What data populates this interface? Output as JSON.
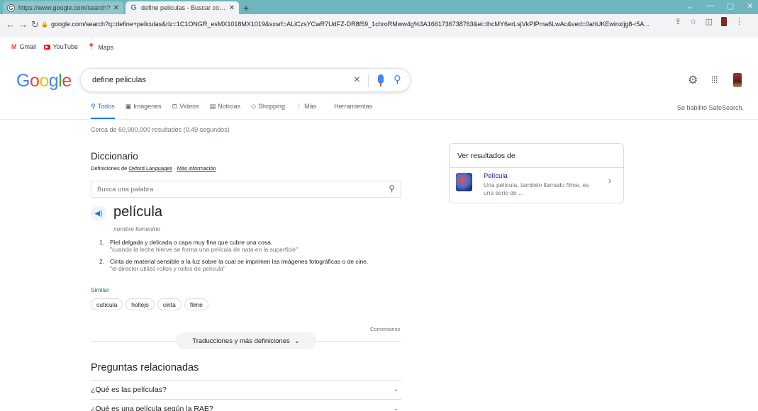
{
  "browser": {
    "tabs": [
      {
        "title": "https://www.google.com/search?",
        "active": false
      },
      {
        "title": "define peliculas - Buscar con Goo",
        "active": true
      }
    ],
    "new_tab": "+",
    "url": "google.com/search?q=define+peliculas&rlz=1C1ONGR_esMX1018MX1019&sxsrf=ALiCzsYCwR7UdFZ-DR8f59_1chroRMww4g%3A1661736738763&ei=lhcMY6erLsjVkPIPma6LwAc&ved=0ahUKEwinxljg8-r5A...",
    "bookmarks": [
      {
        "label": "Gmail",
        "icon": "gmail-icon"
      },
      {
        "label": "YouTube",
        "icon": "youtube-icon"
      },
      {
        "label": "Maps",
        "icon": "maps-icon"
      }
    ]
  },
  "google": {
    "logo_letters": [
      {
        "ch": "G",
        "color": "#4285F4"
      },
      {
        "ch": "o",
        "color": "#EA4335"
      },
      {
        "ch": "o",
        "color": "#FBBC05"
      },
      {
        "ch": "g",
        "color": "#4285F4"
      },
      {
        "ch": "l",
        "color": "#34A853"
      },
      {
        "ch": "e",
        "color": "#EA4335"
      }
    ],
    "query": "define peliculas",
    "tabs": [
      {
        "label": "Todos",
        "icon": "search-icon",
        "active": true
      },
      {
        "label": "Imágenes",
        "icon": "image-icon",
        "active": false
      },
      {
        "label": "Videos",
        "icon": "video-icon",
        "active": false
      },
      {
        "label": "Noticias",
        "icon": "news-icon",
        "active": false
      },
      {
        "label": "Shopping",
        "icon": "tag-icon",
        "active": false
      },
      {
        "label": "Más",
        "icon": "more-icon",
        "active": false
      },
      {
        "label": "Herramientas",
        "icon": "",
        "active": false
      }
    ],
    "safesearch": "Se habilitó SafeSearch.",
    "results_stats": "Cerca de 60,900,000 resultados (0.49 segundos)"
  },
  "dictionary": {
    "title": "Diccionario",
    "source_prefix": "Definiciones de",
    "source_name": "Oxford Languages",
    "source_sep": " · ",
    "more_info": "Más información",
    "search_placeholder": "Busca una palabra",
    "word": "película",
    "part_of_speech": "nombre femenino",
    "definitions": [
      {
        "num": "1.",
        "text": "Piel delgada y delicada o capa muy fina que cubre una cosa.",
        "example": "\"cuando la leche hierve se forma una película de nata en la superficie\""
      },
      {
        "num": "2.",
        "text": "Cinta de material sensible a la luz sobre la cual se imprimen las imágenes fotográficas o de cine.",
        "example": "\"el director utilizó rollos y rollos de película\""
      }
    ],
    "similar_label": "Similar",
    "similar": [
      "cutícula",
      "hollejo",
      "cinta",
      "filme"
    ],
    "feedback": "Comentarios",
    "more_button": "Traducciones y más definiciones"
  },
  "related_questions": {
    "title": "Preguntas relacionadas",
    "items": [
      "¿Qué es las películas?",
      "¿Qué es una película según la RAE?"
    ]
  },
  "side_panel": {
    "title": "Ver resultados de",
    "link": "Película",
    "description": "Una película, también llamado filme, es una serie de ..."
  }
}
